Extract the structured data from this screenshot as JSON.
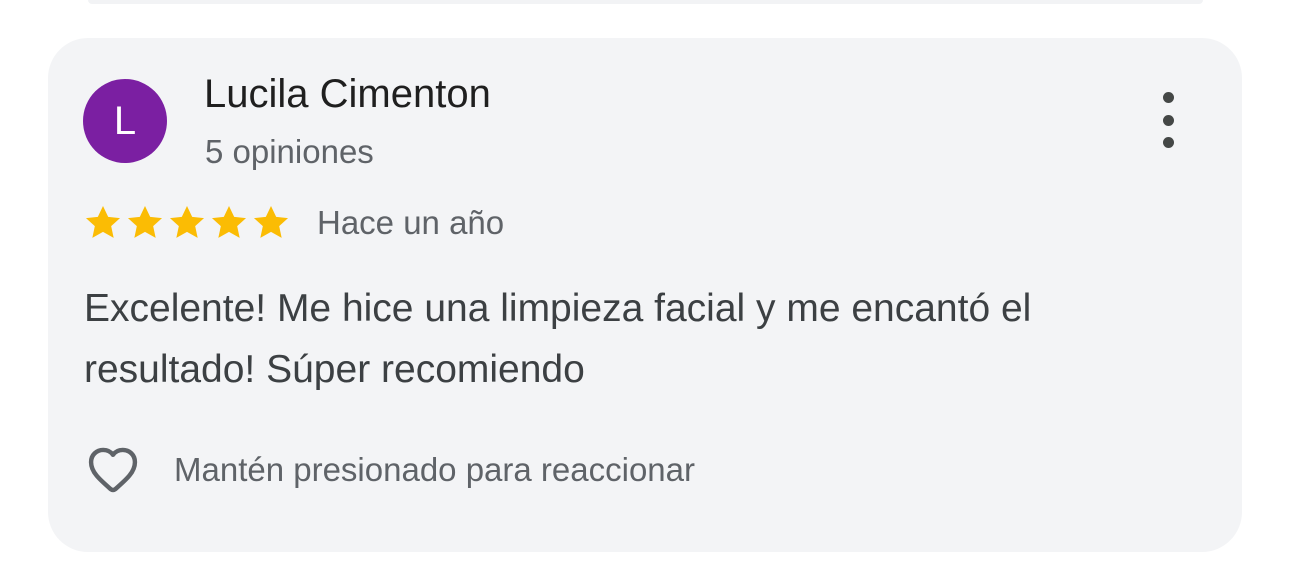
{
  "review": {
    "avatar_initial": "L",
    "avatar_color": "#7b1fa2",
    "author_name": "Lucila Cimenton",
    "author_meta": "5 opiniones",
    "rating": 5,
    "rating_max": 5,
    "star_color": "#fbbc04",
    "date": "Hace un año",
    "text": "Excelente! Me hice una limpieza facial y me encantó el resultado! Súper recomiendo",
    "react_label": "Mantén presionado para reaccionar",
    "react_icon": "heart-outline-icon",
    "more_icon": "more-vertical-icon"
  }
}
